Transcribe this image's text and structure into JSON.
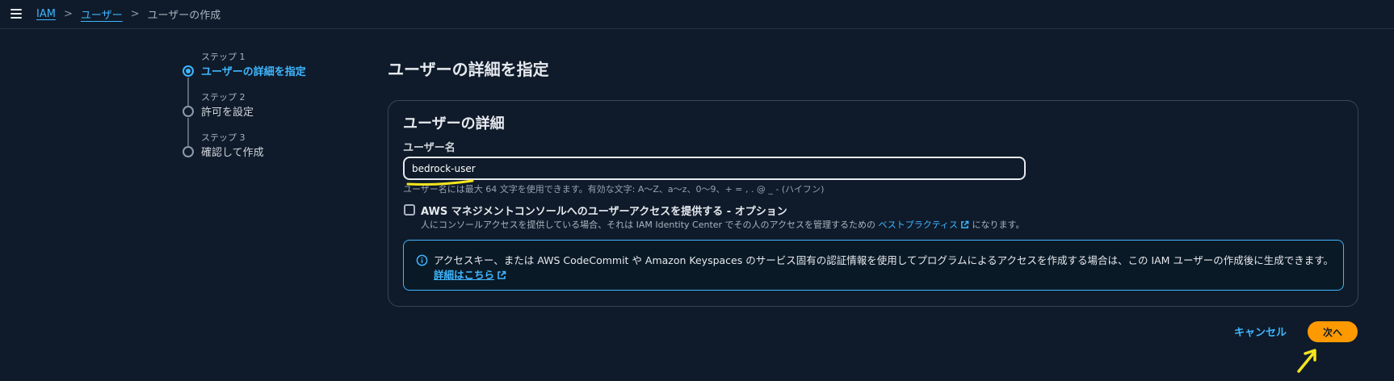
{
  "breadcrumb": {
    "items": [
      "IAM",
      "ユーザー"
    ],
    "current": "ユーザーの作成",
    "separator": ">"
  },
  "steps": [
    {
      "label": "ステップ 1",
      "title": "ユーザーの詳細を指定",
      "active": true
    },
    {
      "label": "ステップ 2",
      "title": "許可を設定",
      "active": false
    },
    {
      "label": "ステップ 3",
      "title": "確認して作成",
      "active": false
    }
  ],
  "page": {
    "title": "ユーザーの詳細を指定"
  },
  "panel": {
    "title": "ユーザーの詳細",
    "username_label": "ユーザー名",
    "username_value": "bedrock-user",
    "username_hint": "ユーザー名には最大 64 文字を使用できます。有効な文字: A〜Z、a〜z、0〜9、+ = , . @ _ - (ハイフン)",
    "console_access": {
      "title": "AWS マネジメントコンソールへのユーザーアクセスを提供する - オプション",
      "desc_before": "人にコンソールアクセスを提供している場合、それは IAM Identity Center でその人のアクセスを管理するための ",
      "desc_link": "ベストプラクティス",
      "desc_after": " になります。",
      "checked": false
    },
    "info": {
      "text": "アクセスキー、または AWS CodeCommit や Amazon Keyspaces のサービス固有の認証情報を使用してプログラムによるアクセスを作成する場合は、この IAM ユーザーの作成後に生成できます。",
      "link": "詳細はこちら"
    }
  },
  "actions": {
    "cancel": "キャンセル",
    "next": "次へ"
  },
  "colors": {
    "accent": "#3fb6ff",
    "primary_button": "#ff9900",
    "background": "#0f1b2a",
    "annotation": "#f5e61e"
  },
  "icons": {
    "menu": "menu-icon",
    "info": "info-icon",
    "external": "external-link-icon"
  }
}
